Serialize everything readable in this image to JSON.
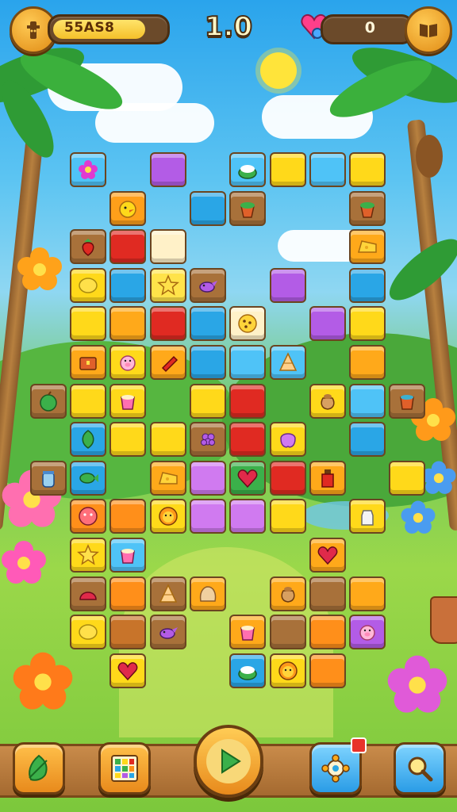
{
  "hud": {
    "score": "55AS8",
    "level": "1.0",
    "lives": "0",
    "score_progress": 0.85,
    "left_button_icon": "totem-icon",
    "right_button_icon": "book-icon",
    "lives_icon": "heart-gem-icon"
  },
  "board": {
    "columns": 9,
    "tiles": [
      {
        "c": 0,
        "r": 0,
        "color": "#4fc3f7",
        "icon": "flower"
      },
      {
        "c": 2,
        "r": 0,
        "color": "#b35ce6",
        "icon": ""
      },
      {
        "c": 4,
        "r": 0,
        "color": "#4fc3f7",
        "icon": "bowl"
      },
      {
        "c": 5,
        "r": 0,
        "color": "#ffd91a",
        "icon": ""
      },
      {
        "c": 6,
        "r": 0,
        "color": "#4fc3f7",
        "icon": ""
      },
      {
        "c": 7,
        "r": 0,
        "color": "#ffd91a",
        "icon": ""
      },
      {
        "c": 1,
        "r": 1,
        "color": "#ff9f1a",
        "icon": "chick"
      },
      {
        "c": 3,
        "r": 1,
        "color": "#2aa6e6",
        "icon": ""
      },
      {
        "c": 4,
        "r": 1,
        "color": "#a8713a",
        "icon": "pot"
      },
      {
        "c": 7,
        "r": 1,
        "color": "#a8713a",
        "icon": "pot"
      },
      {
        "c": 0,
        "r": 2,
        "color": "#a8713a",
        "icon": "strawberry"
      },
      {
        "c": 1,
        "r": 2,
        "color": "#e02a22",
        "icon": ""
      },
      {
        "c": 2,
        "r": 2,
        "color": "#fff1c8",
        "icon": ""
      },
      {
        "c": 7,
        "r": 2,
        "color": "#ffa91a",
        "icon": "cheese"
      },
      {
        "c": 0,
        "r": 3,
        "color": "#ffd91a",
        "icon": "lemon"
      },
      {
        "c": 1,
        "r": 3,
        "color": "#2aa6e6",
        "icon": ""
      },
      {
        "c": 2,
        "r": 3,
        "color": "#ffe34a",
        "icon": "star"
      },
      {
        "c": 3,
        "r": 3,
        "color": "#a8713a",
        "icon": "bird"
      },
      {
        "c": 5,
        "r": 3,
        "color": "#b35ce6",
        "icon": ""
      },
      {
        "c": 7,
        "r": 3,
        "color": "#2aa6e6",
        "icon": ""
      },
      {
        "c": 0,
        "r": 4,
        "color": "#ffd91a",
        "icon": ""
      },
      {
        "c": 1,
        "r": 4,
        "color": "#ffa91a",
        "icon": ""
      },
      {
        "c": 2,
        "r": 4,
        "color": "#e02a22",
        "icon": ""
      },
      {
        "c": 3,
        "r": 4,
        "color": "#2aa6e6",
        "icon": ""
      },
      {
        "c": 4,
        "r": 4,
        "color": "#fff1c8",
        "icon": "cookie"
      },
      {
        "c": 6,
        "r": 4,
        "color": "#b35ce6",
        "icon": ""
      },
      {
        "c": 7,
        "r": 4,
        "color": "#ffd91a",
        "icon": ""
      },
      {
        "c": 0,
        "r": 5,
        "color": "#ffa91a",
        "icon": "chest"
      },
      {
        "c": 1,
        "r": 5,
        "color": "#ffd91a",
        "icon": "pig"
      },
      {
        "c": 2,
        "r": 5,
        "color": "#ffa91a",
        "icon": "candy"
      },
      {
        "c": 3,
        "r": 5,
        "color": "#2aa6e6",
        "icon": ""
      },
      {
        "c": 4,
        "r": 5,
        "color": "#4fc3f7",
        "icon": ""
      },
      {
        "c": 5,
        "r": 5,
        "color": "#4fc3f7",
        "icon": "cone"
      },
      {
        "c": 7,
        "r": 5,
        "color": "#ffa91a",
        "icon": ""
      },
      {
        "c": -1,
        "r": 6,
        "color": "#a8713a",
        "icon": "apple"
      },
      {
        "c": 0,
        "r": 6,
        "color": "#ffd91a",
        "icon": ""
      },
      {
        "c": 1,
        "r": 6,
        "color": "#ffd91a",
        "icon": "cup"
      },
      {
        "c": 3,
        "r": 6,
        "color": "#ffd91a",
        "icon": ""
      },
      {
        "c": 4,
        "r": 6,
        "color": "#e02a22",
        "icon": ""
      },
      {
        "c": 6,
        "r": 6,
        "color": "#ffd91a",
        "icon": "sack"
      },
      {
        "c": 7,
        "r": 6,
        "color": "#4fc3f7",
        "icon": ""
      },
      {
        "c": 8,
        "r": 6,
        "color": "#a8713a",
        "icon": "bucket"
      },
      {
        "c": 0,
        "r": 7,
        "color": "#2aa6e6",
        "icon": "leaf"
      },
      {
        "c": 1,
        "r": 7,
        "color": "#ffd91a",
        "icon": ""
      },
      {
        "c": 2,
        "r": 7,
        "color": "#ffd91a",
        "icon": ""
      },
      {
        "c": 3,
        "r": 7,
        "color": "#a8713a",
        "icon": "grape"
      },
      {
        "c": 4,
        "r": 7,
        "color": "#e02a22",
        "icon": ""
      },
      {
        "c": 5,
        "r": 7,
        "color": "#ffd91a",
        "icon": "blob"
      },
      {
        "c": 7,
        "r": 7,
        "color": "#2aa6e6",
        "icon": ""
      },
      {
        "c": -1,
        "r": 8,
        "color": "#a8713a",
        "icon": "jar"
      },
      {
        "c": 0,
        "r": 8,
        "color": "#2aa6e6",
        "icon": "fish"
      },
      {
        "c": 2,
        "r": 8,
        "color": "#ffa91a",
        "icon": "cheese"
      },
      {
        "c": 3,
        "r": 8,
        "color": "#d07af0",
        "icon": ""
      },
      {
        "c": 4,
        "r": 8,
        "color": "#3bb04a",
        "icon": "heart"
      },
      {
        "c": 5,
        "r": 8,
        "color": "#e02a22",
        "icon": ""
      },
      {
        "c": 6,
        "r": 8,
        "color": "#ffa91a",
        "icon": "bottle"
      },
      {
        "c": 8,
        "r": 8,
        "color": "#ffd91a",
        "icon": ""
      },
      {
        "c": 0,
        "r": 9,
        "color": "#ff8f1a",
        "icon": "face"
      },
      {
        "c": 1,
        "r": 9,
        "color": "#ff8f1a",
        "icon": ""
      },
      {
        "c": 2,
        "r": 9,
        "color": "#ffd91a",
        "icon": "lion"
      },
      {
        "c": 3,
        "r": 9,
        "color": "#d07af0",
        "icon": ""
      },
      {
        "c": 4,
        "r": 9,
        "color": "#d07af0",
        "icon": ""
      },
      {
        "c": 5,
        "r": 9,
        "color": "#ffd91a",
        "icon": ""
      },
      {
        "c": 7,
        "r": 9,
        "color": "#ffd91a",
        "icon": "milk"
      },
      {
        "c": 0,
        "r": 10,
        "color": "#ffd91a",
        "icon": "star"
      },
      {
        "c": 1,
        "r": 10,
        "color": "#4fc3f7",
        "icon": "cup"
      },
      {
        "c": 6,
        "r": 10,
        "color": "#ffa91a",
        "icon": "heart"
      },
      {
        "c": 0,
        "r": 11,
        "color": "#a8713a",
        "icon": "shell"
      },
      {
        "c": 1,
        "r": 11,
        "color": "#ff8f1a",
        "icon": ""
      },
      {
        "c": 2,
        "r": 11,
        "color": "#a8713a",
        "icon": "cone"
      },
      {
        "c": 3,
        "r": 11,
        "color": "#ffa91a",
        "icon": "bread"
      },
      {
        "c": 5,
        "r": 11,
        "color": "#ffa91a",
        "icon": "sack"
      },
      {
        "c": 6,
        "r": 11,
        "color": "#a8713a",
        "icon": ""
      },
      {
        "c": 7,
        "r": 11,
        "color": "#ffa91a",
        "icon": ""
      },
      {
        "c": 0,
        "r": 12,
        "color": "#ffd91a",
        "icon": "lemon"
      },
      {
        "c": 1,
        "r": 12,
        "color": "#c8742a",
        "icon": ""
      },
      {
        "c": 2,
        "r": 12,
        "color": "#a8713a",
        "icon": "bird"
      },
      {
        "c": 4,
        "r": 12,
        "color": "#ffa91a",
        "icon": "cup"
      },
      {
        "c": 5,
        "r": 12,
        "color": "#a8713a",
        "icon": ""
      },
      {
        "c": 6,
        "r": 12,
        "color": "#ff8f1a",
        "icon": ""
      },
      {
        "c": 7,
        "r": 12,
        "color": "#b35ce6",
        "icon": "pig"
      },
      {
        "c": 1,
        "r": 13,
        "color": "#ffd91a",
        "icon": "heart"
      },
      {
        "c": 4,
        "r": 13,
        "color": "#2aa6e6",
        "icon": "bowl"
      },
      {
        "c": 5,
        "r": 13,
        "color": "#ffd91a",
        "icon": "lion"
      },
      {
        "c": 6,
        "r": 13,
        "color": "#ff8f1a",
        "icon": ""
      }
    ]
  },
  "bottom_bar": {
    "buttons": [
      {
        "name": "leaf-button",
        "icon": "leaf-icon"
      },
      {
        "name": "grid-button",
        "icon": "grid-icon"
      },
      {
        "name": "play-button",
        "icon": "play-icon"
      },
      {
        "name": "settings-button",
        "icon": "gear-icon"
      },
      {
        "name": "search-button",
        "icon": "search-icon"
      }
    ]
  },
  "colors": {
    "wood": "#a8713a",
    "sky": "#2aa4ec",
    "grass": "#7cc83c"
  }
}
